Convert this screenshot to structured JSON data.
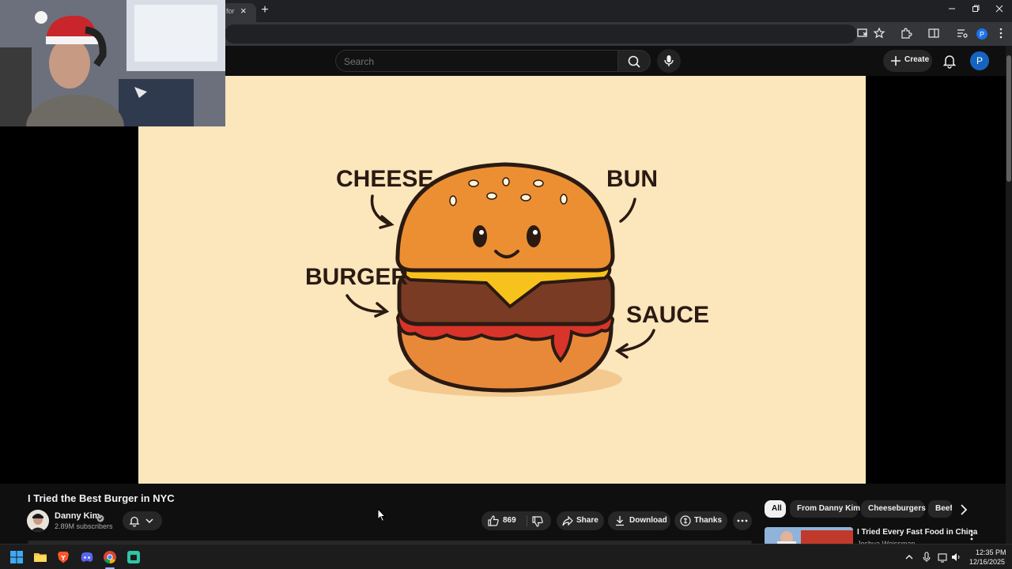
{
  "browser": {
    "tab_title": "for",
    "tab_close": "×",
    "new_tab": "+"
  },
  "youtube_header": {
    "search_placeholder": "Search",
    "create_label": "Create",
    "avatar_letter": "P",
    "accent": "#1565c0"
  },
  "video_frame": {
    "labels": {
      "cheese": "CHEESE",
      "bun": "BUN",
      "burger": "BURGER",
      "sauce": "SAUCE"
    },
    "background": "#fce6bc"
  },
  "video": {
    "title": "I Tried the Best Burger in NYC",
    "channel": "Danny Kim",
    "subscribers": "2.89M subscribers",
    "like_count": "869",
    "share_label": "Share",
    "download_label": "Download",
    "thanks_label": "Thanks"
  },
  "chips": {
    "items": [
      "All",
      "From Danny Kim",
      "Cheeseburgers",
      "Beef"
    ]
  },
  "recommendation": {
    "title": "I Tried Every Fast Food in China",
    "channel": "Joshua Weissman"
  },
  "taskbar": {
    "time": "12:35 PM",
    "date": "12/16/2025"
  },
  "icons": [
    "search-icon",
    "mic-icon",
    "bell-icon",
    "plus-icon",
    "thumbs-up-icon",
    "thumbs-down-icon",
    "share-icon",
    "download-icon",
    "thanks-icon",
    "more-icon",
    "chevron-right-icon",
    "windows-start-icon",
    "file-explorer-icon",
    "brave-icon",
    "discord-icon",
    "chrome-icon"
  ]
}
